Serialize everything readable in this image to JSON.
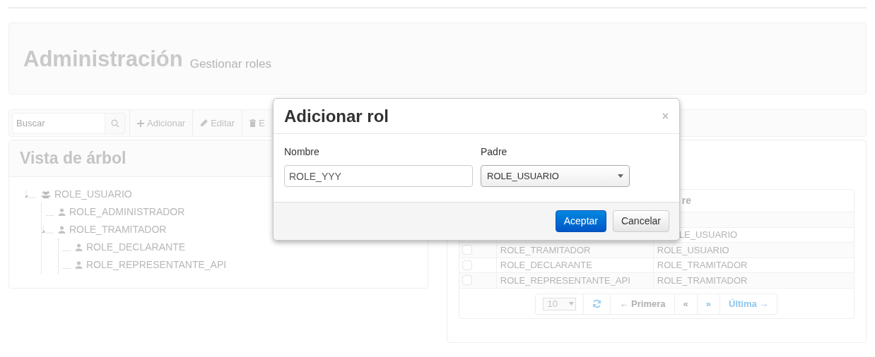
{
  "header": {
    "title": "Administración",
    "subtitle": "Gestionar roles"
  },
  "toolbar": {
    "search": {
      "placeholder": "Buscar"
    },
    "buttons": [
      {
        "kind": "plus",
        "label": "Adicionar"
      },
      {
        "kind": "pencil",
        "label": "Editar"
      },
      {
        "kind": "trash",
        "label": "E"
      }
    ]
  },
  "tree_panel": {
    "title": "Vista de árbol",
    "tree": [
      {
        "label": "ROLE_USUARIO",
        "kind": "group",
        "expanded": true,
        "children": [
          {
            "label": "ROLE_ADMINISTRADOR",
            "kind": "user"
          },
          {
            "label": "ROLE_TRAMITADOR",
            "kind": "user",
            "expanded": true,
            "children": [
              {
                "label": "ROLE_DECLARANTE",
                "kind": "user"
              },
              {
                "label": "ROLE_REPRESENTANTE_API",
                "kind": "user"
              }
            ]
          }
        ]
      }
    ]
  },
  "table": {
    "columns": [
      {
        "label": "re",
        "cut_left": true
      }
    ],
    "rows": [
      {
        "name": "",
        "parent": ""
      },
      {
        "name": "",
        "parent": "LE_USUARIO",
        "cut_left": true
      },
      {
        "name": "ROLE_TRAMITADOR",
        "parent": "ROLE_USUARIO",
        "checked": false
      },
      {
        "name": "ROLE_DECLARANTE",
        "parent": "ROLE_TRAMITADOR",
        "checked": false
      },
      {
        "name": "ROLE_REPRESENTANTE_API",
        "parent": "ROLE_TRAMITADOR",
        "checked": false
      }
    ],
    "pagination": {
      "page_size": "10",
      "items": [
        {
          "kind": "refresh",
          "disabled": false
        },
        {
          "label": "← Primera",
          "disabled": true
        },
        {
          "label": "«",
          "disabled": true
        },
        {
          "label": "»",
          "disabled": false
        },
        {
          "label": "Última →",
          "disabled": false
        }
      ]
    }
  },
  "dialog": {
    "title": "Adicionar rol",
    "close": "×",
    "fields": [
      {
        "kind": "text",
        "label": "Nombre",
        "value": "ROLE_YYY"
      },
      {
        "kind": "select",
        "label": "Padre",
        "value": "ROLE_USUARIO"
      }
    ],
    "buttons": [
      {
        "label": "Aceptar",
        "primary": true
      },
      {
        "label": "Cancelar",
        "primary": false
      }
    ]
  }
}
